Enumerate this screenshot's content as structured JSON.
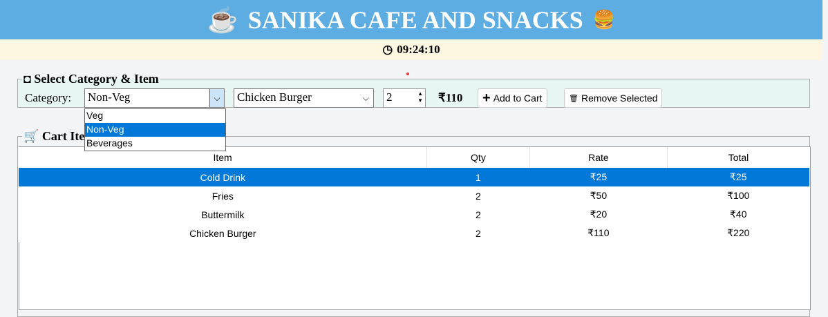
{
  "header": {
    "title": "SANIKA CAFE AND SNACKS",
    "left_icon": "coffee-cup-icon",
    "right_icon": "burger-icon"
  },
  "clock": {
    "icon": "clock-icon",
    "time": "09:24:10"
  },
  "select_section": {
    "title": "Select Category & Item",
    "category_label": "Category:",
    "category_value": "Non-Veg",
    "category_options": [
      "Veg",
      "Non-Veg",
      "Beverages"
    ],
    "item_value": "Chicken Burger",
    "quantity": "2",
    "price": "₹110",
    "add_label": "Add to Cart",
    "remove_label": "Remove Selected"
  },
  "cart": {
    "title": "Cart Items",
    "columns": [
      "Item",
      "Qty",
      "Rate",
      "Total"
    ],
    "rows": [
      [
        "Cold Drink",
        "1",
        "₹25",
        "₹25"
      ],
      [
        "Fries",
        "2",
        "₹50",
        "₹100"
      ],
      [
        "Buttermilk",
        "2",
        "₹20",
        "₹40"
      ],
      [
        "Chicken Burger",
        "2",
        "₹110",
        "₹220"
      ]
    ],
    "selected_row": 0
  },
  "colors": {
    "header": "#5dade2",
    "selection": "#0078d7"
  }
}
